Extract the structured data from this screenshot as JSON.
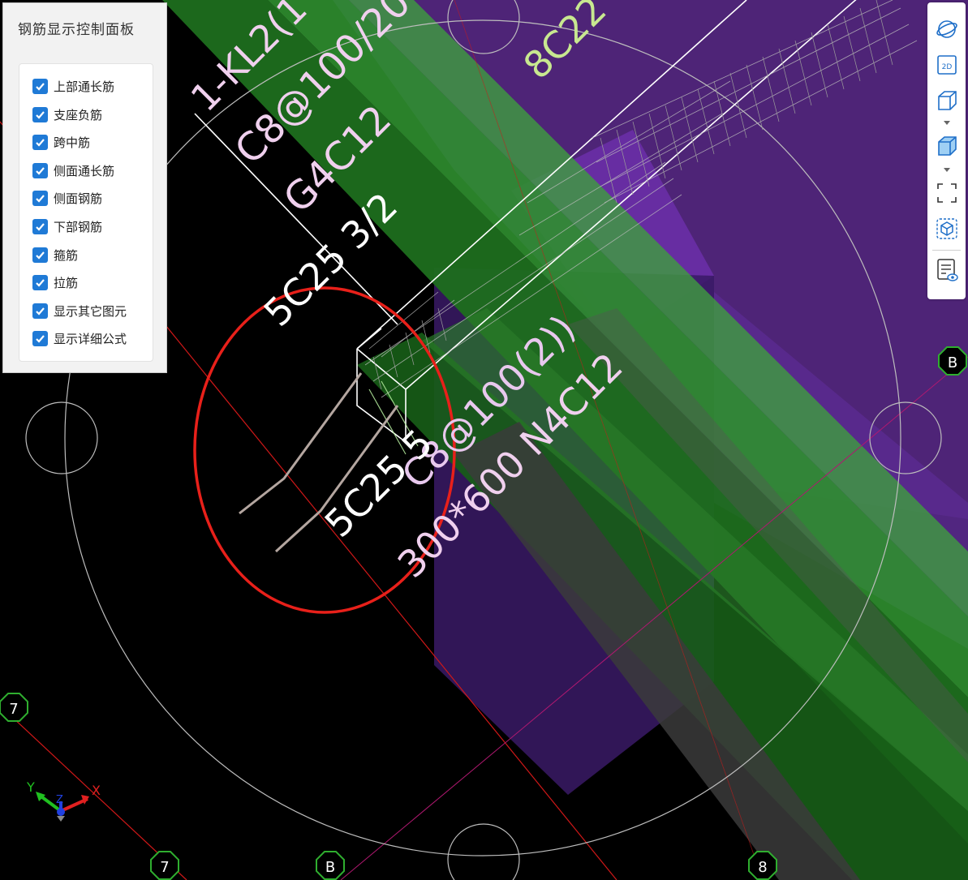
{
  "panel": {
    "title": "钢筋显示控制面板",
    "options": [
      {
        "label": "上部通长筋",
        "checked": true
      },
      {
        "label": "支座负筋",
        "checked": true
      },
      {
        "label": "跨中筋",
        "checked": true
      },
      {
        "label": "侧面通长筋",
        "checked": true
      },
      {
        "label": "侧面钢筋",
        "checked": true
      },
      {
        "label": "下部钢筋",
        "checked": true
      },
      {
        "label": "箍筋",
        "checked": true
      },
      {
        "label": "拉筋",
        "checked": true
      },
      {
        "label": "显示其它图元",
        "checked": true
      },
      {
        "label": "显示详细公式",
        "checked": true
      }
    ]
  },
  "toolbar": {
    "items": [
      "orbit-icon",
      "view-2d-icon",
      "box-wireframe-icon",
      "box-solid-icon",
      "selection-frame-icon",
      "cube-select-icon",
      "report-view-icon"
    ],
    "view_2d_label": "2D"
  },
  "annotations": {
    "beam_name": "1-KL2(1",
    "stirrup_upper": "C8@100/20",
    "side_bar_g": "G4C12",
    "bottom_bar_upper": "5C25 3/2",
    "top_bar": "8C22",
    "stirrup_lower": "C8@100(2))",
    "bottom_bar_lower": "5C25 5",
    "section_n": "300*600 N4C12"
  },
  "grid_labels": {
    "left": "7",
    "bottom_7": "7",
    "bottom_b": "B",
    "bottom_8": "8",
    "right_b": "B"
  },
  "axis_gizmo": {
    "x": "X",
    "y": "Y",
    "z": "Z"
  },
  "colors": {
    "purple": "#5a2a86",
    "green": "#2f8f2f",
    "highlight": "#e8201a",
    "checkbox": "#1f7ad6"
  }
}
